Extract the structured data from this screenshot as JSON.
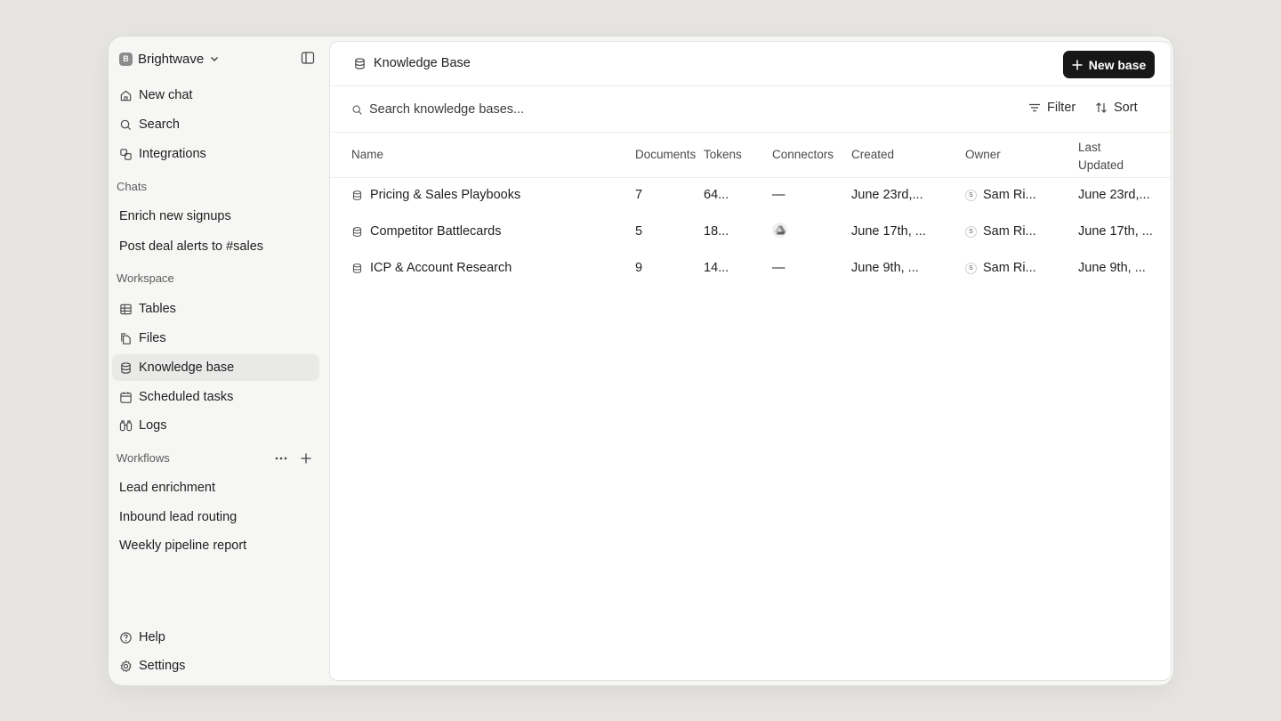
{
  "workspace": {
    "initial": "B",
    "name": "Brightwave"
  },
  "nav": {
    "new_chat": "New chat",
    "search": "Search",
    "integrations": "Integrations"
  },
  "chats": {
    "label": "Chats",
    "items": [
      "Enrich new signups",
      "Post deal alerts to #sales"
    ]
  },
  "workspace_section": {
    "label": "Workspace",
    "tables": "Tables",
    "files": "Files",
    "knowledge_base": "Knowledge base",
    "scheduled_tasks": "Scheduled tasks",
    "logs": "Logs"
  },
  "workflows": {
    "label": "Workflows",
    "items": [
      "Lead enrichment",
      "Inbound lead routing",
      "Weekly pipeline report"
    ]
  },
  "footer": {
    "help": "Help",
    "settings": "Settings"
  },
  "page": {
    "title": "Knowledge Base",
    "new_button": "New base"
  },
  "toolbar": {
    "search_placeholder": "Search knowledge bases...",
    "filter": "Filter",
    "sort": "Sort"
  },
  "table": {
    "headers": {
      "name": "Name",
      "documents": "Documents",
      "tokens": "Tokens",
      "connectors": "Connectors",
      "created": "Created",
      "owner": "Owner",
      "last_updated_1": "Last",
      "last_updated_2": "Updated"
    },
    "rows": [
      {
        "name": "Pricing & Sales Playbooks",
        "documents": "7",
        "tokens": "64...",
        "connectors": "—",
        "created": "June 23rd,...",
        "owner_initial": "S",
        "owner": "Sam Ri...",
        "updated": "June 23rd,..."
      },
      {
        "name": "Competitor Battlecards",
        "documents": "5",
        "tokens": "18...",
        "connectors": "google-drive-icon",
        "created": "June 17th, ...",
        "owner_initial": "S",
        "owner": "Sam Ri...",
        "updated": "June 17th, ..."
      },
      {
        "name": "ICP & Account Research",
        "documents": "9",
        "tokens": "14...",
        "connectors": "—",
        "created": "June 9th, ...",
        "owner_initial": "S",
        "owner": "Sam Ri...",
        "updated": "June 9th, ..."
      }
    ]
  }
}
